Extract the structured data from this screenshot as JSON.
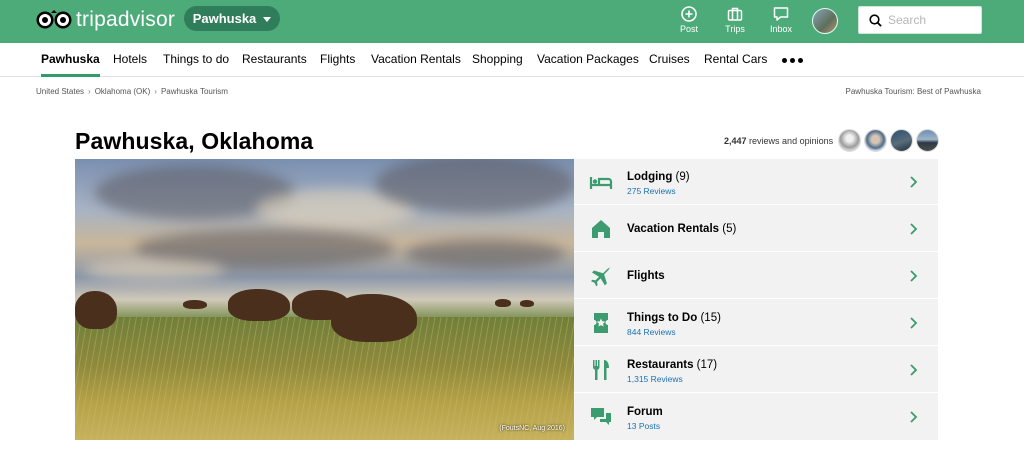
{
  "brand": {
    "name": "tripadvisor",
    "color": "#4daa79"
  },
  "header": {
    "location_pill": "Pawhuska",
    "post_label": "Post",
    "trips_label": "Trips",
    "inbox_label": "Inbox",
    "search_placeholder": "Search"
  },
  "nav": {
    "items": [
      "Pawhuska",
      "Hotels",
      "Things to do",
      "Restaurants",
      "Flights",
      "Vacation Rentals",
      "Shopping",
      "Vacation Packages",
      "Cruises",
      "Rental Cars"
    ],
    "active_index": 0
  },
  "breadcrumb": {
    "items": [
      "United States",
      "Oklahoma (OK)",
      "Pawhuska Tourism"
    ],
    "right_text": "Pawhuska Tourism: Best of Pawhuska"
  },
  "page": {
    "title": "Pawhuska, Oklahoma",
    "reviews_count": "2,447",
    "reviews_suffix": "reviews and opinions"
  },
  "hero": {
    "credit": "(FoutsNC, Aug 2016)"
  },
  "categories": [
    {
      "name": "Lodging",
      "count": "(9)",
      "sub": "275 Reviews",
      "icon": "bed-icon"
    },
    {
      "name": "Vacation Rentals",
      "count": "(5)",
      "sub": "",
      "icon": "house-icon"
    },
    {
      "name": "Flights",
      "count": "",
      "sub": "",
      "icon": "airplane-icon"
    },
    {
      "name": "Things to Do",
      "count": "(15)",
      "sub": "844 Reviews",
      "icon": "ticket-icon"
    },
    {
      "name": "Restaurants",
      "count": "(17)",
      "sub": "1,315 Reviews",
      "icon": "fork-knife-icon"
    },
    {
      "name": "Forum",
      "count": "",
      "sub": "13 Posts",
      "icon": "chat-bubbles-icon"
    }
  ]
}
